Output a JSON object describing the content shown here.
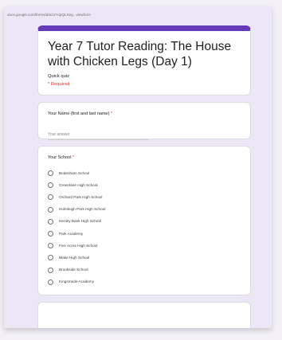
{
  "browser": {
    "url": "docs.google.com/forms/d/e/1FAIpQLSeg...viewform"
  },
  "form": {
    "title": "Year 7 Tutor Reading: The House with Chicken Legs (Day 1)",
    "subtitle": "Quick quiz",
    "required_note": "* Required",
    "accent_color": "#673ab7",
    "background_color": "#ece7f4"
  },
  "questions": {
    "name": {
      "label": "Your Name (first and last name)",
      "required_mark": "*",
      "placeholder": "Your answer"
    },
    "school": {
      "label": "Your School",
      "required_mark": "*",
      "options": [
        "Bodenham School",
        "Greenlane High School",
        "Orchard Park High School",
        "Holmleigh Park High School",
        "Henley Bank High School",
        "Park Academy",
        "Five Acres High School",
        "Blake High School",
        "Brookside School",
        "Kingsmede Academy"
      ]
    }
  }
}
